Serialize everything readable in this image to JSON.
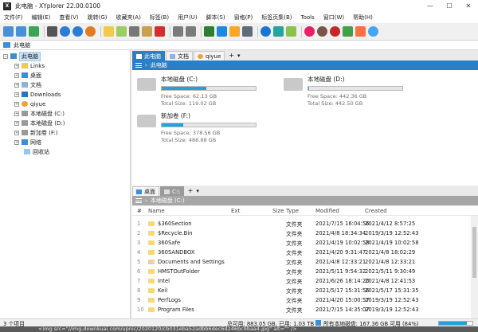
{
  "window": {
    "title": "此电脑 - XYplorer 22.00.0100",
    "logo": "X"
  },
  "window_controls": [
    "—",
    "☐",
    "✕"
  ],
  "menu": [
    "文件(F)",
    "编辑(E)",
    "查看(V)",
    "跳转(G)",
    "收藏夹(A)",
    "标签(B)",
    "用户(U)",
    "脚本(S)",
    "窗格(P)",
    "标签页集(B)",
    "Tools",
    "窗口(W)",
    "帮助(H)"
  ],
  "address": {
    "value": "此电脑"
  },
  "tree": {
    "root": "此电脑",
    "items": [
      {
        "label": "Links",
        "icon": "link-folder-icon"
      },
      {
        "label": "桌面",
        "icon": "desktop-icon"
      },
      {
        "label": "文档",
        "icon": "documents-icon"
      },
      {
        "label": "Downloads",
        "icon": "download-icon"
      },
      {
        "label": "qiyue",
        "icon": "user-icon"
      },
      {
        "label": "本地磁盘 (C:)",
        "icon": "drive-icon"
      },
      {
        "label": "本地磁盘 (D:)",
        "icon": "drive-icon"
      },
      {
        "label": "新加卷 (F:)",
        "icon": "drive-icon"
      },
      {
        "label": "网络",
        "icon": "network-icon"
      },
      {
        "label": "回收站",
        "icon": "recycle-bin-icon"
      }
    ]
  },
  "pane1": {
    "tabs": [
      "此电脑",
      "文档",
      "qiyue"
    ],
    "add": "+",
    "menu": "▾",
    "path": "此电脑",
    "drives": [
      {
        "name": "本地磁盘 (C:)",
        "free": "Free Space: 62.13 GB",
        "total": "Total Size: 119.02 GB",
        "used_fraction": 0.478
      },
      {
        "name": "本地磁盘 (D:)",
        "free": "Free Space: 442.36 GB",
        "total": "Total Size: 442.50 GB",
        "used_fraction": 0.0003
      },
      {
        "name": "新加卷 (F:)",
        "free": "Free Space: 378.56 GB",
        "total": "Total Size: 488.88 GB",
        "used_fraction": 0.226
      }
    ]
  },
  "pane2": {
    "tabs": [
      "桌面",
      "C:\\"
    ],
    "add": "+",
    "menu": "▾",
    "path": "本地磁盘 (C:)",
    "columns": {
      "num": "#",
      "name": "Name",
      "ext": "Ext",
      "size": "Size",
      "type": "Type",
      "modified": "Modified",
      "created": "Created"
    },
    "rows": [
      {
        "num": "1",
        "name": "$360Section",
        "type": "文件夹",
        "modified": "2021/7/15 16:04:56",
        "created": "2021/4/12 8:57:25"
      },
      {
        "num": "2",
        "name": "$Recycle.Bin",
        "type": "文件夹",
        "modified": "2021/4/8 18:34:34",
        "created": "2019/3/19 12:52:43"
      },
      {
        "num": "3",
        "name": "360Safe",
        "type": "文件夹",
        "modified": "2021/4/19 10:02:58",
        "created": "2021/4/19 10:02:58"
      },
      {
        "num": "4",
        "name": "360SANDBOX",
        "type": "文件夹",
        "modified": "2021/4/20 9:31:47",
        "created": "2021/4/8 18:02:29"
      },
      {
        "num": "5",
        "name": "Documents and Settings",
        "type": "文件夹",
        "modified": "2021/4/8 12:33:21",
        "created": "2021/4/8 12:33:21"
      },
      {
        "num": "6",
        "name": "HMSTOutFolder",
        "type": "文件夹",
        "modified": "2021/5/11 9:54:32",
        "created": "2021/5/11 9:30:49"
      },
      {
        "num": "7",
        "name": "Intel",
        "type": "文件夹",
        "modified": "2021/6/26 18:14:20",
        "created": "2021/4/8 12:41:53"
      },
      {
        "num": "8",
        "name": "Keil",
        "type": "文件夹",
        "modified": "2021/5/17 15:31:56",
        "created": "2021/5/17 15:31:35"
      },
      {
        "num": "9",
        "name": "PerfLogs",
        "type": "文件夹",
        "modified": "2021/4/20 15:00:57",
        "created": "2019/3/19 12:52:43"
      },
      {
        "num": "10",
        "name": "Program Files",
        "type": "文件夹",
        "modified": "2021/7/15 14:35:07",
        "created": "2019/3/19 12:52:43"
      }
    ]
  },
  "status": {
    "count": "3 个项目",
    "total": "总可用: 883.05 GB, 已用: 1.03 TB",
    "disk": "所有本地磁盘: 167.36 GB 可用 (84%)"
  },
  "bottom_strip": "<img src=\"//img.downkuai.com/upnic/2020120/cb031eba52adbb6dec6d246bc9baa4.jpg\" alt=\"\" />"
}
